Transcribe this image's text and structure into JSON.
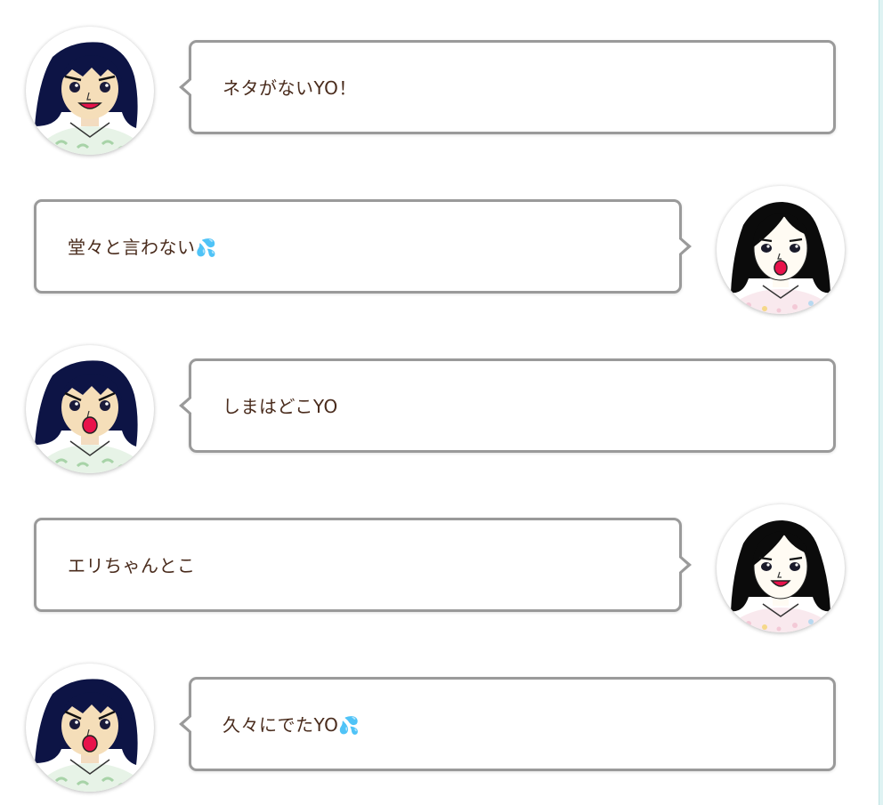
{
  "colors": {
    "text": "#4a2c1d",
    "bubble_border": "#9a9a9a",
    "right_edge": "#dff3f3"
  },
  "messages": [
    {
      "side": "left",
      "avatar": "girl-dark-bangs-avatar",
      "expression": "smile",
      "text": "ネタがないYO！",
      "emoji": ""
    },
    {
      "side": "right",
      "avatar": "woman-black-hair-avatar",
      "expression": "open-mouth",
      "text": "堂々と言わない",
      "emoji": "💦"
    },
    {
      "side": "left",
      "avatar": "girl-dark-bangs-avatar",
      "expression": "open-mouth",
      "text": "しまはどこYO",
      "emoji": ""
    },
    {
      "side": "right",
      "avatar": "woman-black-hair-avatar",
      "expression": "smile",
      "text": "エリちゃんとこ",
      "emoji": ""
    },
    {
      "side": "left",
      "avatar": "girl-dark-bangs-avatar",
      "expression": "open-mouth",
      "text": "久々にでたYO",
      "emoji": "💦"
    }
  ]
}
